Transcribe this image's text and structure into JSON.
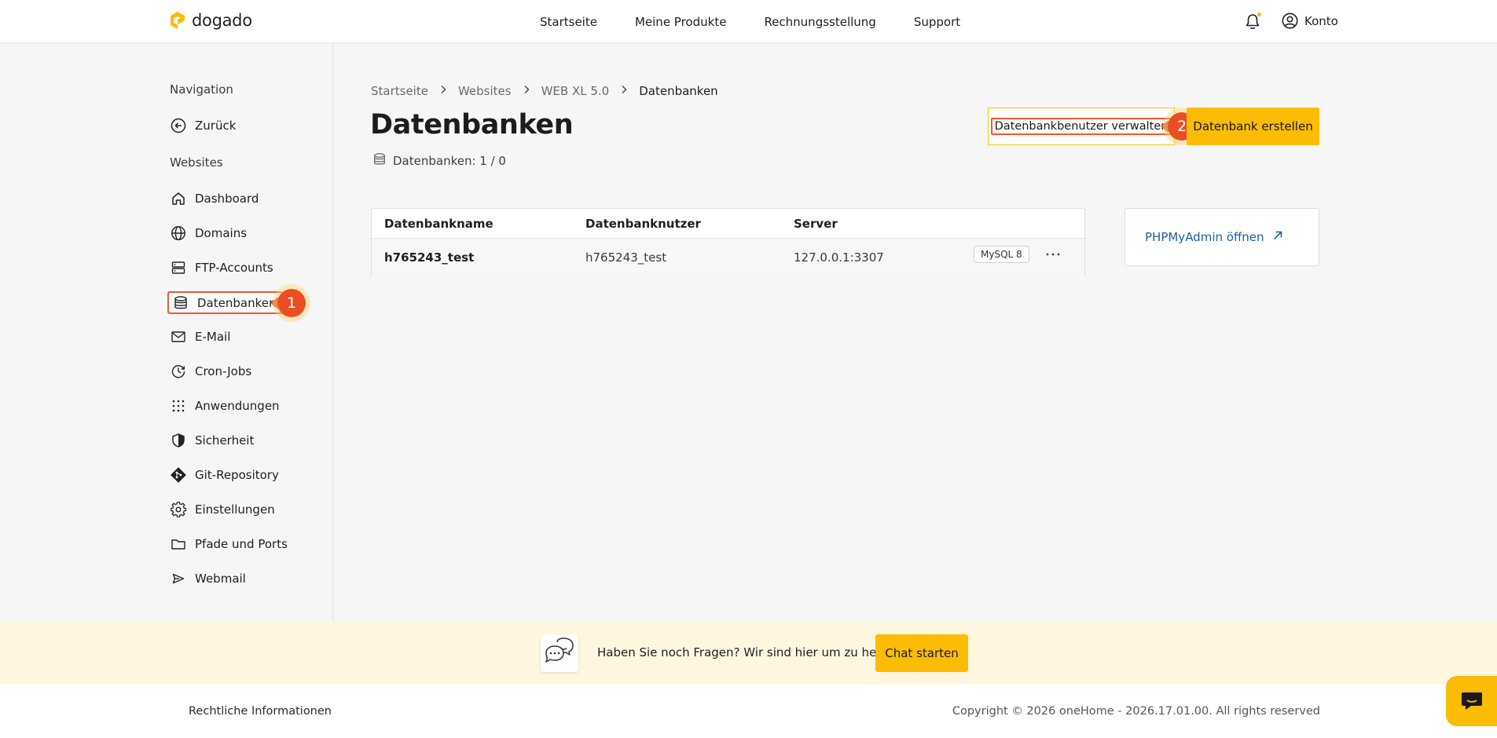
{
  "header": {
    "logo_text": "dogado",
    "nav": [
      "Startseite",
      "Meine Produkte",
      "Rechnungsstellung",
      "Support"
    ],
    "account_label": "Konto",
    "notification_dot_color": "#f5b800"
  },
  "sidebar": {
    "heading_navigation": "Navigation",
    "back_label": "Zurück",
    "heading_websites": "Websites",
    "items": [
      {
        "label": "Dashboard",
        "icon": "home-icon"
      },
      {
        "label": "Domains",
        "icon": "globe-icon"
      },
      {
        "label": "FTP-Accounts",
        "icon": "server-icon"
      },
      {
        "label": "Datenbanken",
        "icon": "database-icon",
        "active": true
      },
      {
        "label": "E-Mail",
        "icon": "mail-icon"
      },
      {
        "label": "Cron-Jobs",
        "icon": "clock-icon"
      },
      {
        "label": "Anwendungen",
        "icon": "grid-icon"
      },
      {
        "label": "Sicherheit",
        "icon": "shield-icon"
      },
      {
        "label": "Git-Repository",
        "icon": "git-icon"
      },
      {
        "label": "Einstellungen",
        "icon": "gear-icon"
      },
      {
        "label": "Pfade und Ports",
        "icon": "folder-icon"
      },
      {
        "label": "Webmail",
        "icon": "send-icon"
      }
    ]
  },
  "annotations": {
    "marker_1": "1",
    "marker_2": "2"
  },
  "main": {
    "breadcrumb": [
      "Startseite",
      "Websites",
      "WEB XL 5.0",
      "Datenbanken"
    ],
    "title": "Datenbanken",
    "db_count": "Datenbanken: 1 / 0",
    "btn_manage_users": "Datenbankbenutzer verwalten",
    "btn_create": "Datenbank erstellen",
    "table": {
      "columns": [
        "Datenbankname",
        "Datenbanknutzer",
        "Server"
      ],
      "rows": [
        {
          "name": "h765243_test",
          "user": "h765243_test",
          "server": "127.0.0.1:3307",
          "badge": "MySQL 8"
        }
      ]
    },
    "phpmyadmin_label": "PHPMyAdmin öffnen"
  },
  "help": {
    "text": "Haben Sie noch Fragen? Wir sind hier um zu helfen.",
    "chat_button": "Chat starten"
  },
  "footer": {
    "legal": "Rechtliche Informationen",
    "copyright": "Copyright © 2026 oneHome - 2026.17.01.00. All rights reserved"
  },
  "colors": {
    "accent": "#fbbc05",
    "marker": "#eb4e24",
    "link": "#1f5fa0"
  }
}
